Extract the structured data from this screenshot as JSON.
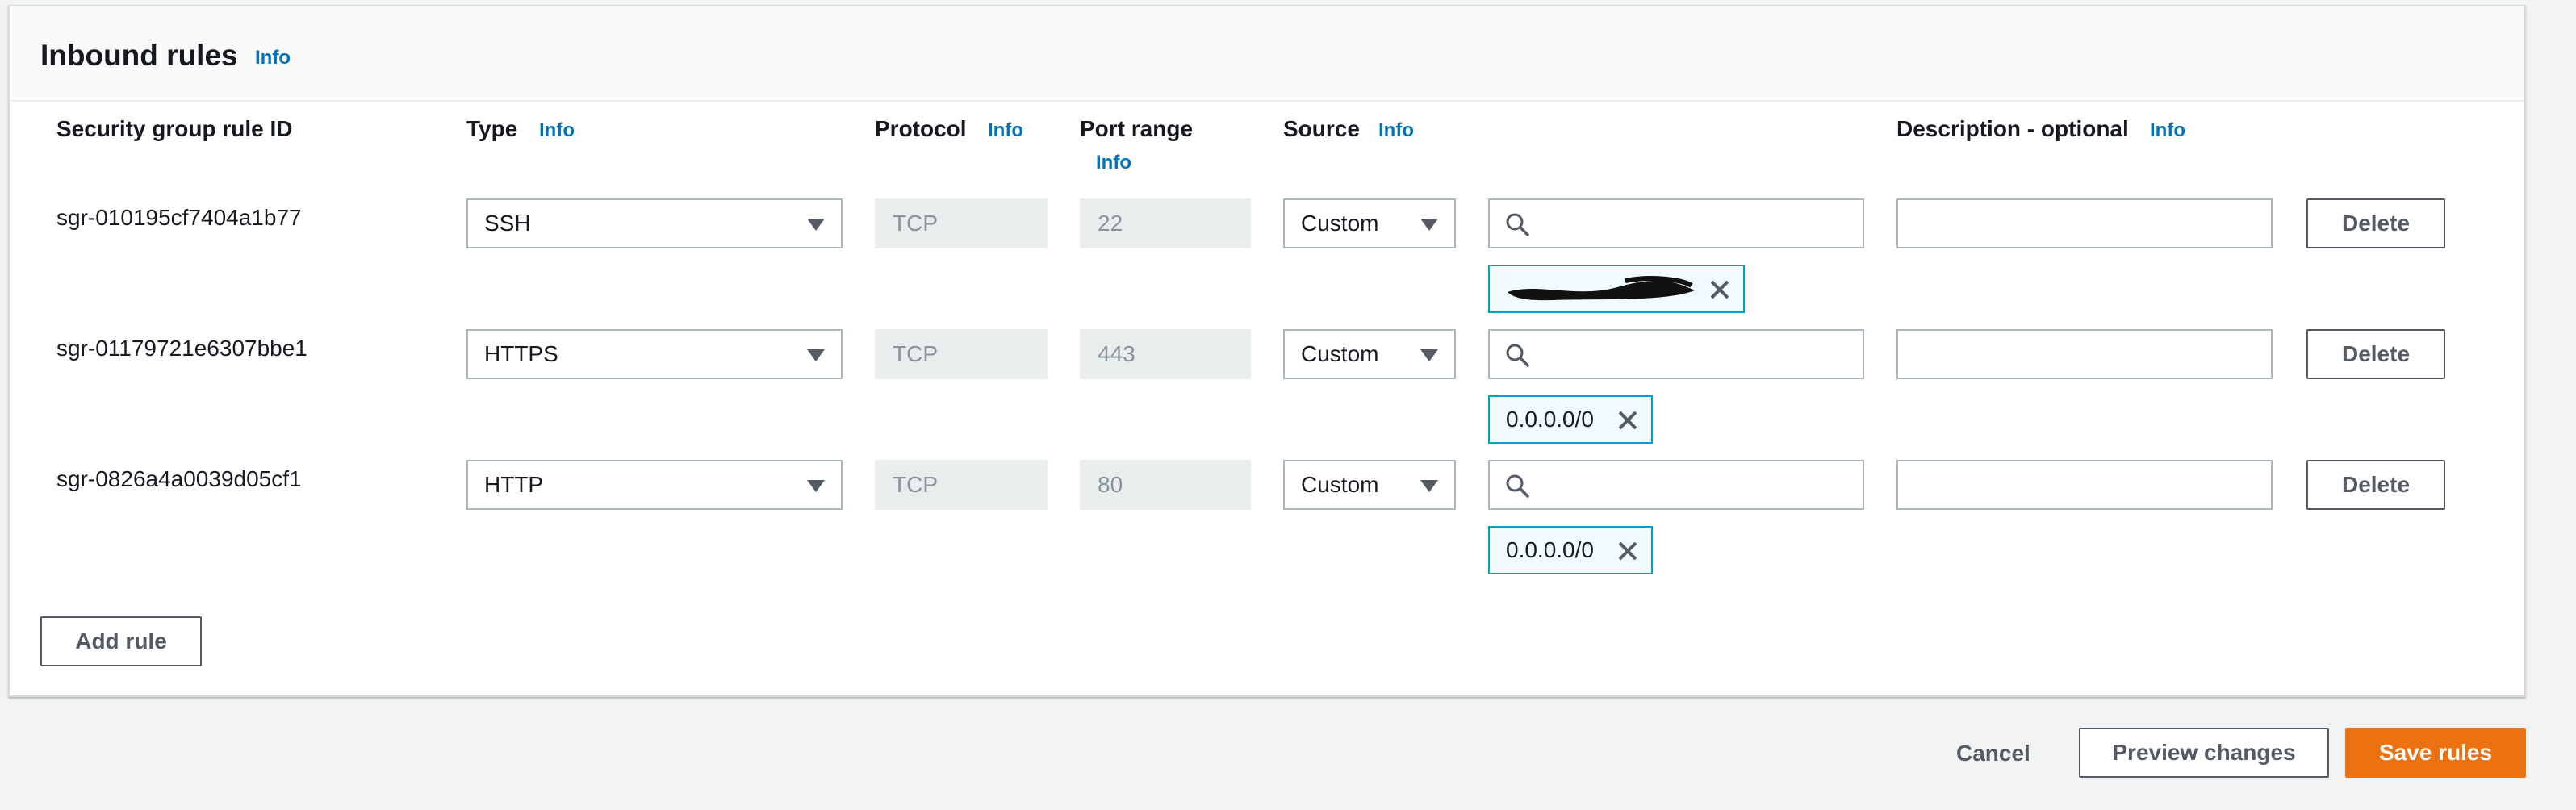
{
  "panel": {
    "title": "Inbound rules",
    "info": "Info"
  },
  "columns": {
    "rule_id": "Security group rule ID",
    "type": "Type",
    "protocol": "Protocol",
    "port_range": "Port range",
    "source": "Source",
    "description": "Description - optional",
    "info": "Info"
  },
  "rules": [
    {
      "id": "sgr-010195cf7404a1b77",
      "type": "SSH",
      "protocol": "TCP",
      "port": "22",
      "source": "Custom",
      "search_value": "",
      "description": "",
      "token": "",
      "token_redacted": true,
      "delete": "Delete"
    },
    {
      "id": "sgr-01179721e6307bbe1",
      "type": "HTTPS",
      "protocol": "TCP",
      "port": "443",
      "source": "Custom",
      "search_value": "",
      "description": "",
      "token": "0.0.0.0/0",
      "token_redacted": false,
      "delete": "Delete"
    },
    {
      "id": "sgr-0826a4a0039d05cf1",
      "type": "HTTP",
      "protocol": "TCP",
      "port": "80",
      "source": "Custom",
      "search_value": "",
      "description": "",
      "token": "0.0.0.0/0",
      "token_redacted": false,
      "delete": "Delete"
    }
  ],
  "add_rule": "Add rule",
  "footer": {
    "cancel": "Cancel",
    "preview": "Preview changes",
    "save": "Save rules"
  },
  "colors": {
    "accent_link": "#0073bb",
    "primary_button": "#ec7211",
    "token_border": "#00a1c9"
  }
}
